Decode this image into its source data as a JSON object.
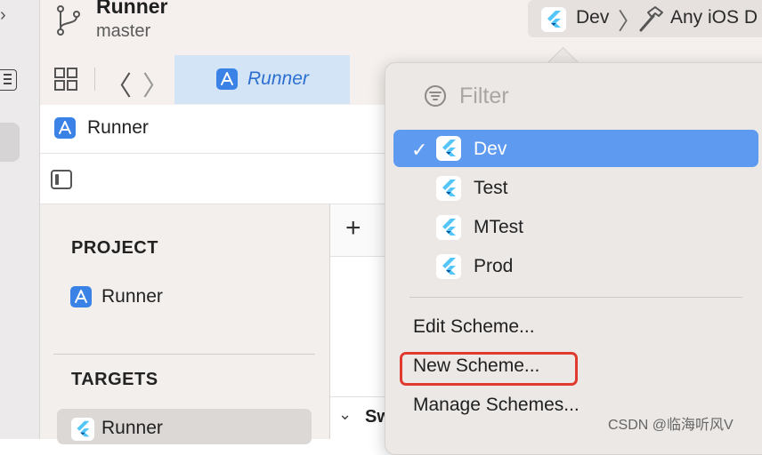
{
  "titlebar": {
    "title": "Runner",
    "subtitle": "master",
    "scheme": "Dev",
    "separator": "〉",
    "device": "Any iOS D"
  },
  "tabbar": {
    "tab_label": "Runner",
    "back": "〈",
    "forward": "〉"
  },
  "breadcrumb": {
    "label": "Runner"
  },
  "left_panel": {
    "project_header": "PROJECT",
    "project_item": "Runner",
    "targets_header": "TARGETS",
    "target_item": "Runner"
  },
  "editor": {
    "plus": "+",
    "chevron": "⌄",
    "section_label": "Sw"
  },
  "menu": {
    "filter_placeholder": "Filter",
    "checkmark": "✓",
    "schemes": [
      {
        "label": "Dev",
        "selected": true
      },
      {
        "label": "Test",
        "selected": false
      },
      {
        "label": "MTest",
        "selected": false
      },
      {
        "label": "Prod",
        "selected": false
      }
    ],
    "commands": {
      "edit": "Edit Scheme...",
      "new": "New Scheme...",
      "manage": "Manage Schemes..."
    }
  },
  "watermark": "CSDN @临海听风V",
  "colors": {
    "accent": "#5e9bf0",
    "tab_selected": "#d4e4f7",
    "highlight_box": "#e03a2e",
    "flutter_light": "#54c5f8",
    "flutter_dark": "#01579b"
  }
}
